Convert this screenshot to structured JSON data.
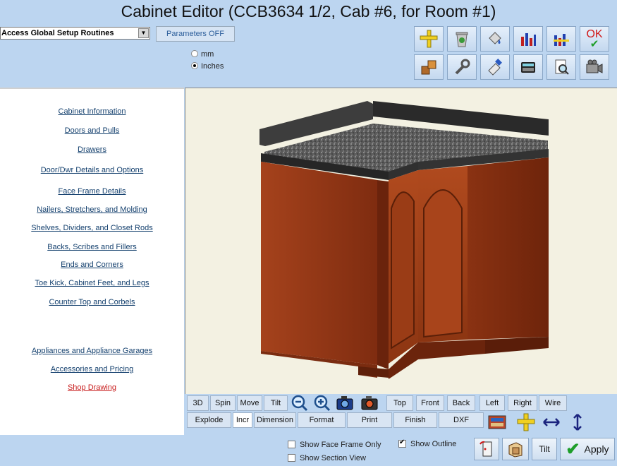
{
  "window": {
    "title": "Cabinet Editor (CCB3634 1/2, Cab #6, for Room #1)"
  },
  "top": {
    "setup_select": {
      "value": "Access Global Setup Routines"
    },
    "parameters_button": "Parameters OFF",
    "units": [
      {
        "label": "mm",
        "selected": false
      },
      {
        "label": "Inches",
        "selected": true
      }
    ],
    "ok_label": "OK",
    "toolbar_icons": [
      "ruler-icon",
      "recycle-bin-icon",
      "paint-bucket-icon",
      "bar-chart-icon",
      "chart-settings-icon",
      "ok-icon",
      "blocks-icon",
      "wrench-icon",
      "paint-icon",
      "calculator-icon",
      "print-preview-icon",
      "camera-icon"
    ]
  },
  "sidebar": {
    "items": [
      {
        "label": "Cabinet Information"
      },
      {
        "label": "Doors and Pulls"
      },
      {
        "label": "Drawers"
      },
      {
        "label": "Door/Dwr Details and Options"
      },
      {
        "label": "Face Frame Details"
      },
      {
        "label": "Nailers, Stretchers, and  Molding"
      },
      {
        "label": "Shelves, Dividers, and Closet Rods"
      },
      {
        "label": "Backs, Scribes and Fillers"
      },
      {
        "label": "Ends and Corners"
      },
      {
        "label": "Toe Kick, Cabinet Feet, and Legs"
      },
      {
        "label": "Counter Top and Corbels"
      },
      {
        "label": "Appliances and Appliance Garages"
      },
      {
        "label": "Accessories and Pricing"
      },
      {
        "label": "Shop Drawing"
      }
    ]
  },
  "view_toolbar": {
    "row1": [
      "3D",
      "Spin",
      "Move",
      "Tilt",
      "Top",
      "Front",
      "Back",
      "Left",
      "Right",
      "Wire"
    ],
    "row2": [
      "Explode",
      "Incr",
      "Dimension",
      "Format",
      "Print",
      "Finish",
      "DXF"
    ]
  },
  "options": {
    "show_face_frame_only": {
      "label": "Show Face Frame Only",
      "checked": false
    },
    "show_outline": {
      "label": "Show Outline",
      "checked": true
    },
    "show_section_view": {
      "label": "Show Section View",
      "checked": false
    }
  },
  "bottom_buttons": {
    "tilt": "Tilt",
    "apply": "Apply"
  },
  "colors": {
    "background": "#bcd5f0",
    "link": "#14406e",
    "link_highlight": "#c81d1d",
    "ok_red": "#d01818",
    "check_green": "#1e9e2a"
  }
}
